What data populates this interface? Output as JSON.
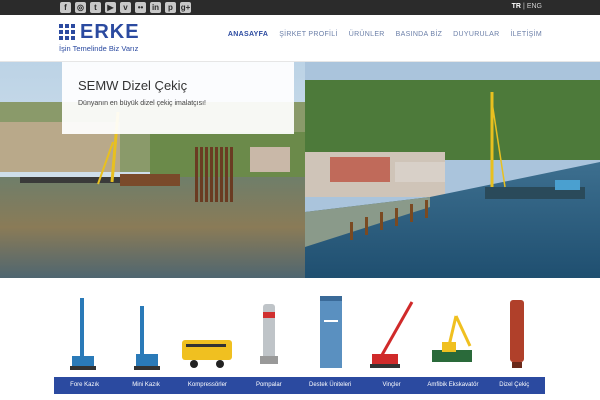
{
  "topbar": {
    "social_icons": [
      "facebook-icon",
      "instagram-icon",
      "twitter-icon",
      "youtube-icon",
      "vimeo-icon",
      "flickr-icon",
      "linkedin-icon",
      "pinterest-icon",
      "google-plus-icon"
    ],
    "lang_tr": "TR",
    "lang_sep": "|",
    "lang_eng": "ENG"
  },
  "logo": {
    "brand": "ERKE",
    "tagline": "İşin Temelinde Biz Varız",
    "color": "#2b4aa0"
  },
  "nav": {
    "items": [
      "ANASAYFA",
      "ŞİRKET PROFİLİ",
      "ÜRÜNLER",
      "BASINDA BİZ",
      "DUYURULAR",
      "İLETİŞİM"
    ],
    "active_index": 0
  },
  "slider": {
    "title": "SEMW Dizel Çekiç",
    "subtitle": "Dünyanın en büyük dizel çekiç imalatçısı!",
    "slide_count": 3,
    "active_slide": 0
  },
  "products": {
    "categories": [
      "Fore Kazık",
      "Mini Kazık",
      "Kompressörler",
      "Pompalar",
      "Destek Üniteleri",
      "Vinçler",
      "Amfibik Ekskavatör",
      "Dizel Çekiç"
    ]
  },
  "colors": {
    "brand_blue": "#2b4aa0",
    "topbar": "#2b2b2b"
  }
}
